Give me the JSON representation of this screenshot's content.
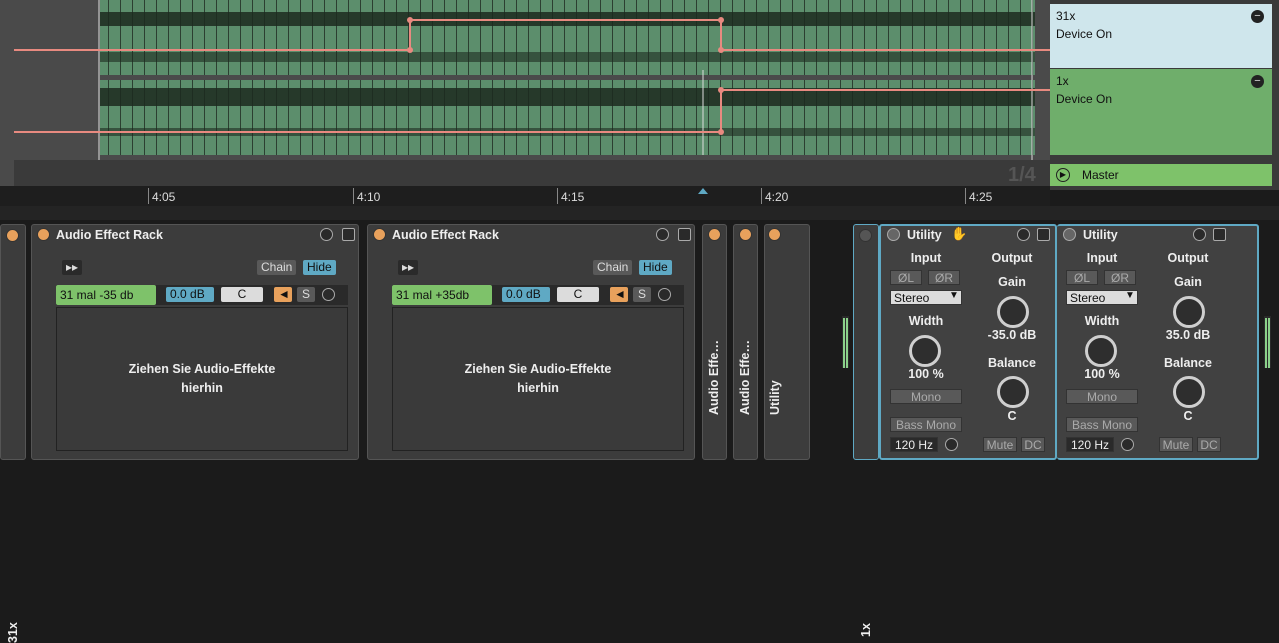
{
  "arrangement": {
    "ruler_ticks": [
      "4:05",
      "4:10",
      "4:15",
      "4:20",
      "4:25"
    ],
    "page_indicator": "1/4"
  },
  "chain_list": {
    "items": [
      {
        "name": "31x",
        "status": "Device On",
        "color": "#cfe6ec"
      },
      {
        "name": "1x",
        "status": "Device On",
        "color": "#6fae6b"
      }
    ],
    "master_label": "Master"
  },
  "device_chain": {
    "left_chain_label": "31x",
    "racks": [
      {
        "title": "Audio Effect Rack",
        "chain_label": "Chain",
        "hide_label": "Hide",
        "chain_name": "31 mal -35 db",
        "volume": "0.0 dB",
        "pan": "C",
        "solo": "S",
        "drop_text_line1": "Ziehen Sie Audio-Effekte",
        "drop_text_line2": "hierhin"
      },
      {
        "title": "Audio Effect Rack",
        "chain_label": "Chain",
        "hide_label": "Hide",
        "chain_name": "31 mal +35db",
        "volume": "0.0 dB",
        "pan": "C",
        "solo": "S",
        "drop_text_line1": "Ziehen Sie Audio-Effekte",
        "drop_text_line2": "hierhin"
      }
    ],
    "folded_devices": [
      "Audio Effe…",
      "Audio Effe…",
      "Utility"
    ],
    "right_chain_label": "1x",
    "utilities": [
      {
        "title": "Utility",
        "input": "Input",
        "output": "Output",
        "phase_l": "ØL",
        "phase_r": "ØR",
        "channel_mode": "Stereo",
        "gain_label": "Gain",
        "gain_value": "-35.0 dB",
        "width_label": "Width",
        "width_value": "100 %",
        "mono": "Mono",
        "balance_label": "Balance",
        "balance_value": "C",
        "bass_mono": "Bass Mono",
        "bass_freq": "120 Hz",
        "mute": "Mute",
        "dc": "DC"
      },
      {
        "title": "Utility",
        "input": "Input",
        "output": "Output",
        "phase_l": "ØL",
        "phase_r": "ØR",
        "channel_mode": "Stereo",
        "gain_label": "Gain",
        "gain_value": "35.0 dB",
        "width_label": "Width",
        "width_value": "100 %",
        "mono": "Mono",
        "balance_label": "Balance",
        "balance_value": "C",
        "bass_mono": "Bass Mono",
        "bass_freq": "120 Hz",
        "mute": "Mute",
        "dc": "DC"
      }
    ]
  },
  "colors": {
    "accent": "#5fa9c4",
    "activator": "#e8a15c",
    "chain_green": "#7ec26a",
    "automation": "#e88a80",
    "clip": "#5a8c6a"
  }
}
